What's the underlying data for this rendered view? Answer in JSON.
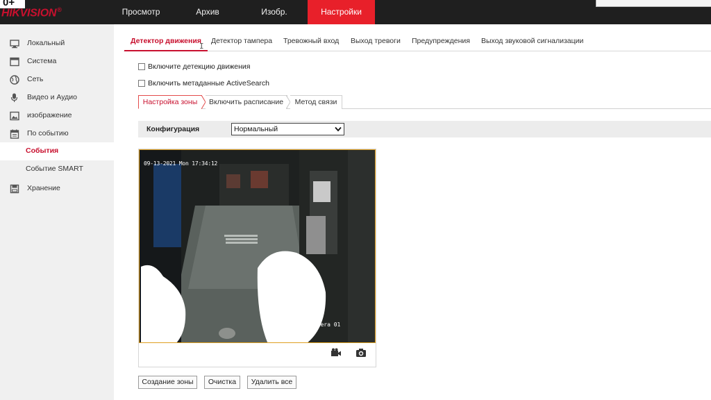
{
  "header": {
    "age_badge": "0+",
    "logo_text": "HIKVISION",
    "logo_reg": "®",
    "nav": [
      {
        "label": "Просмотр"
      },
      {
        "label": "Архив"
      },
      {
        "label": "Изобр."
      },
      {
        "label": "Настройки",
        "active": true
      }
    ]
  },
  "sidebar": {
    "items": [
      {
        "label": "Локальный",
        "icon": "monitor-icon"
      },
      {
        "label": "Система",
        "icon": "system-icon"
      },
      {
        "label": "Сеть",
        "icon": "globe-icon"
      },
      {
        "label": "Видео и Аудио",
        "icon": "microphone-icon"
      },
      {
        "label": "изображение",
        "icon": "image-icon"
      },
      {
        "label": "По событию",
        "icon": "calendar-icon"
      },
      {
        "label": "Хранение",
        "icon": "storage-icon"
      }
    ],
    "sub_items": [
      {
        "label": "События",
        "active": true
      },
      {
        "label": "Событие SMART"
      }
    ]
  },
  "tabs": [
    {
      "label": "Детектор движения",
      "active": true
    },
    {
      "label": "Детектор тампера"
    },
    {
      "label": "Тревожный вход"
    },
    {
      "label": "Выход тревоги"
    },
    {
      "label": "Предупреждения"
    },
    {
      "label": "Выход звуковой сигнализации"
    }
  ],
  "checkboxes": {
    "enable_motion": "Включите детекцию движения",
    "enable_metadata": "Включить метаданные ActiveSearch"
  },
  "subtabs": [
    {
      "label": "Настройка зоны",
      "active": true
    },
    {
      "label": "Включить расписание"
    },
    {
      "label": "Метод связи"
    }
  ],
  "config": {
    "label": "Конфигурация",
    "value": "Нормальный"
  },
  "video": {
    "osd_time": "09-13-2021 Mon 17:34:12",
    "osd_camera": "Camera 01",
    "tools": [
      "record-icon",
      "camera-icon"
    ]
  },
  "buttons": {
    "create_zone": "Создание зоны",
    "clear": "Очистка",
    "delete_all": "Удалить все"
  },
  "colors": {
    "accent": "#c8102e",
    "topbar": "#1f1f1f",
    "active_nav": "#e8202a"
  }
}
